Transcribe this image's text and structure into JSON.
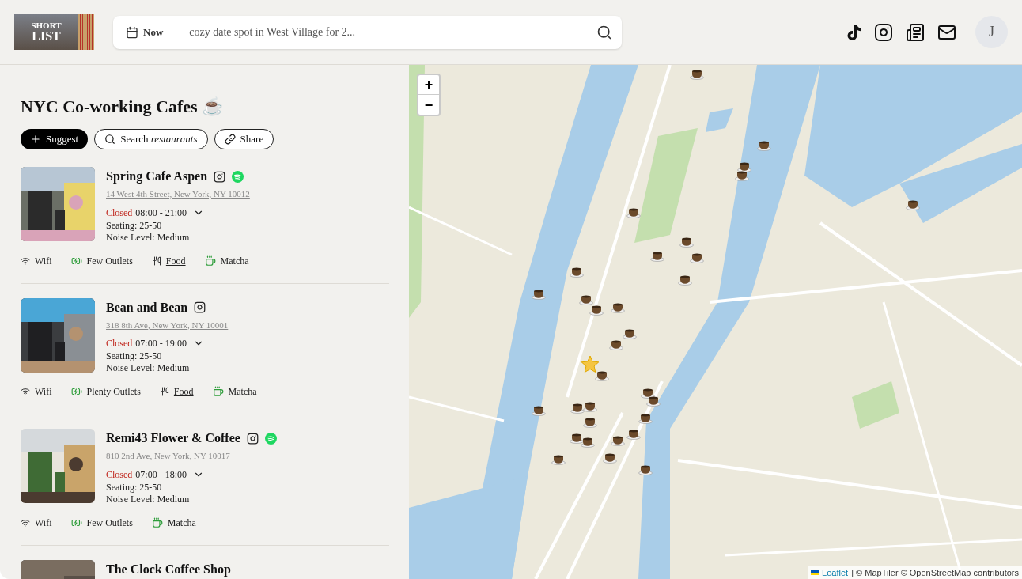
{
  "logo": {
    "lines": [
      "SHORT",
      "LIST"
    ]
  },
  "search": {
    "date_label": "Now",
    "placeholder": "cozy date spot in West Village for 2..."
  },
  "header_icons": [
    {
      "kind": "tiktok"
    },
    {
      "kind": "instagram"
    },
    {
      "kind": "newspaper"
    },
    {
      "kind": "mail"
    }
  ],
  "avatar": {
    "initial": "J"
  },
  "list": {
    "title": "NYC Co-working Cafes ☕",
    "buttons": [
      {
        "kind": "suggest",
        "label": "Suggest"
      },
      {
        "kind": "search",
        "label": "Search *restaurants*"
      },
      {
        "kind": "share",
        "label": "Share"
      }
    ]
  },
  "places": [
    {
      "name": "Spring Cafe Aspen",
      "socials": [
        {
          "kind": "instagram"
        },
        {
          "kind": "spotify"
        }
      ],
      "address": "14 West 4th Street, New York, NY 10012",
      "status": "Closed",
      "hours": "08:00 - 21:00",
      "seating": "Seating: 25-50",
      "noise": "Noise Level: Medium",
      "amenities": [
        {
          "kind": "wifi",
          "label": "Wifi"
        },
        {
          "kind": "outlets",
          "label": "Few Outlets"
        },
        {
          "kind": "food",
          "label": "Food"
        },
        {
          "kind": "matcha",
          "label": "Matcha"
        }
      ]
    },
    {
      "name": "Bean and Bean",
      "socials": [
        {
          "kind": "instagram"
        }
      ],
      "address": "318 8th Ave, New York, NY 10001",
      "status": "Closed",
      "hours": "07:00 - 19:00",
      "seating": "Seating: 25-50",
      "noise": "Noise Level: Medium",
      "amenities": [
        {
          "kind": "wifi",
          "label": "Wifi"
        },
        {
          "kind": "outlets",
          "label": "Plenty Outlets"
        },
        {
          "kind": "food",
          "label": "Food"
        },
        {
          "kind": "matcha",
          "label": "Matcha"
        }
      ]
    },
    {
      "name": "Remi43 Flower & Coffee",
      "socials": [
        {
          "kind": "instagram"
        },
        {
          "kind": "spotify"
        }
      ],
      "address": "810 2nd Ave, New York, NY 10017",
      "status": "Closed",
      "hours": "07:00 - 18:00",
      "seating": "Seating: 25-50",
      "noise": "Noise Level: Medium",
      "amenities": [
        {
          "kind": "wifi",
          "label": "Wifi"
        },
        {
          "kind": "outlets",
          "label": "Few Outlets"
        },
        {
          "kind": "matcha",
          "label": "Matcha"
        }
      ]
    },
    {
      "name": "The Clock Coffee Shop"
    }
  ],
  "map": {
    "zoom": [
      "+",
      "−"
    ],
    "attribution_link": "Leaflet",
    "attribution": "| © MapTiler © OpenStreetMap contributors"
  }
}
